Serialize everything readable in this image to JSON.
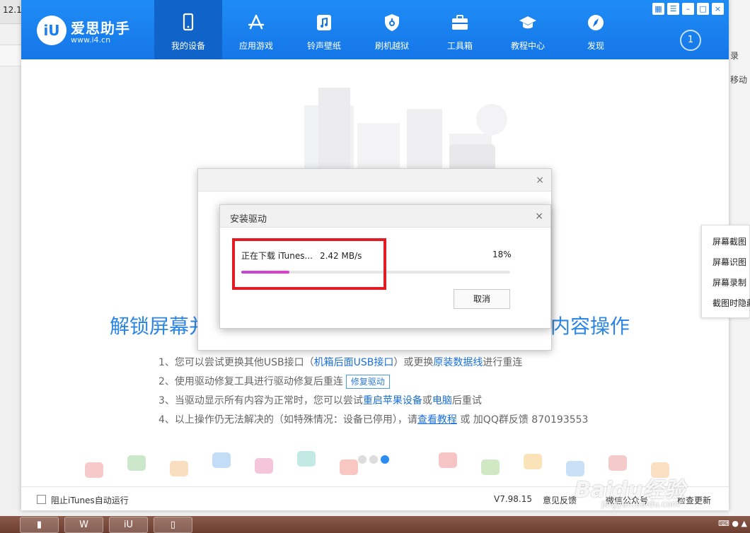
{
  "bg_window": {
    "version_fragment": "12.1",
    "side_fragments": [
      "录",
      "移动"
    ]
  },
  "app": {
    "logo_mark": "iU",
    "name": "爱思助手",
    "url": "www.i4.cn",
    "nav": [
      {
        "label": "我的设备",
        "icon": "phone-icon",
        "active": true
      },
      {
        "label": "应用游戏",
        "icon": "app-store-icon",
        "active": false
      },
      {
        "label": "铃声壁纸",
        "icon": "music-icon",
        "active": false
      },
      {
        "label": "刷机越狱",
        "icon": "shield-icon",
        "active": false
      },
      {
        "label": "工具箱",
        "icon": "toolbox-icon",
        "active": false
      },
      {
        "label": "教程中心",
        "icon": "graduation-cap-icon",
        "active": false
      },
      {
        "label": "发现",
        "icon": "compass-icon",
        "active": false
      }
    ],
    "download_count": "1",
    "window_controls": [
      "shirt-icon",
      "menu-icon",
      "minimize-icon",
      "maximize-icon",
      "close-icon"
    ]
  },
  "content": {
    "headline_left": "解锁屏幕并",
    "headline_right": "下内容操作",
    "step1_a": "1、您可以尝试更换其他USB接口（",
    "step1_link1": "机箱后面USB接口",
    "step1_b": "）或更换",
    "step1_link2": "原装数据线",
    "step1_c": "进行重连",
    "step2_a": "2、使用驱动修复工具进行驱动修复后重连",
    "step2_button": "修复驱动",
    "step3_a": "3、当驱动显示所有内容为正常时，您可以尝试",
    "step3_link1": "重启苹果设备",
    "step3_b": "或",
    "step3_link2": "电脑",
    "step3_c": "后重试",
    "step4_a": "4、以上操作仍无法解决的（如特殊情况：设备已停用），请",
    "step4_link": "查看教程",
    "step4_b": "或 加QQ群反馈 870193553"
  },
  "bottom": {
    "checkbox_label": "阻止iTunes自动运行",
    "version": "V7.98.15",
    "feedback": "意见反馈",
    "wechat": "微信公众号",
    "check_update": "检查更新"
  },
  "dialog": {
    "title": "安装驱动",
    "status": "正在下载 iTunes...",
    "speed": "2.42 MB/s",
    "percent_text": "18%",
    "progress_fraction": 0.18,
    "cancel_label": "取消",
    "highlight_color": "#e31b23",
    "close_glyph": "×"
  },
  "context_menu": {
    "items": [
      "屏幕截图",
      "屏幕识图",
      "屏幕录制",
      "截图时隐藏"
    ]
  },
  "watermark": {
    "main": "Baidu经验",
    "sub": "jingyan.baidu.com"
  }
}
